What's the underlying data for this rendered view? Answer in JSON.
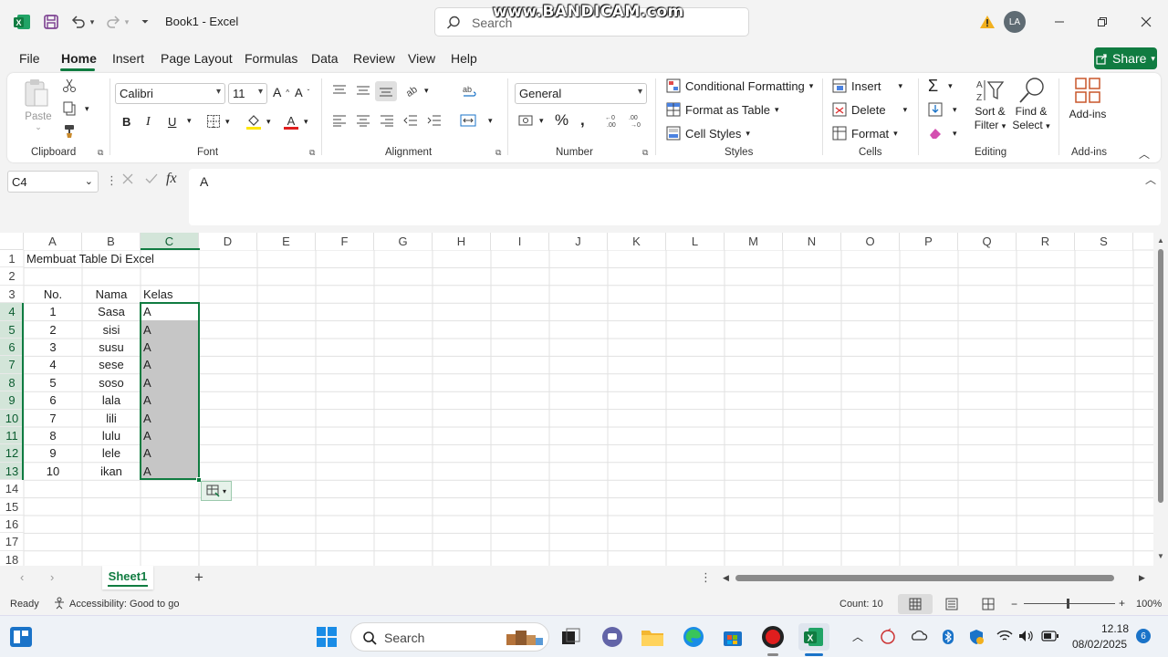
{
  "titlebar": {
    "doc_title": "Book1  -  Excel",
    "search_placeholder": "Search",
    "watermark": "www.BANDICAM.com",
    "avatar_initials": "LA"
  },
  "menu": {
    "tabs": [
      "File",
      "Home",
      "Insert",
      "Page Layout",
      "Formulas",
      "Data",
      "Review",
      "View",
      "Help"
    ],
    "active": "Home",
    "share_label": "Share"
  },
  "ribbon": {
    "clipboard": {
      "paste_label": "Paste",
      "group_label": "Clipboard"
    },
    "font": {
      "font_name": "Calibri",
      "font_size": "11",
      "group_label": "Font"
    },
    "alignment": {
      "group_label": "Alignment"
    },
    "number": {
      "format": "General",
      "group_label": "Number"
    },
    "styles": {
      "conditional_formatting": "Conditional Formatting",
      "format_as_table": "Format as Table",
      "cell_styles": "Cell Styles",
      "group_label": "Styles"
    },
    "cells": {
      "insert": "Insert",
      "delete": "Delete",
      "format": "Format",
      "group_label": "Cells"
    },
    "editing": {
      "sort_filter_1": "Sort &",
      "sort_filter_2": "Filter",
      "find_select_1": "Find &",
      "find_select_2": "Select",
      "group_label": "Editing"
    },
    "addins": {
      "addins_label": "Add-ins",
      "group_label": "Add-ins"
    }
  },
  "formula_bar": {
    "name_box": "C4",
    "content": "A"
  },
  "columns": [
    "A",
    "B",
    "C",
    "D",
    "E",
    "F",
    "G",
    "H",
    "I",
    "J",
    "K",
    "L",
    "M",
    "N",
    "O",
    "P",
    "Q",
    "R",
    "S"
  ],
  "rows": [
    "1",
    "2",
    "3",
    "4",
    "5",
    "6",
    "7",
    "8",
    "9",
    "10",
    "11",
    "12",
    "13",
    "14",
    "15",
    "16",
    "17",
    "18"
  ],
  "cells": {
    "title": "Membuat Table Di Excel",
    "header_no": "No.",
    "header_nama": "Nama",
    "header_kelas": "Kelas",
    "data": [
      {
        "no": "1",
        "nama": "Sasa",
        "kelas": "A"
      },
      {
        "no": "2",
        "nama": "sisi",
        "kelas": "A"
      },
      {
        "no": "3",
        "nama": "susu",
        "kelas": "A"
      },
      {
        "no": "4",
        "nama": "sese",
        "kelas": "A"
      },
      {
        "no": "5",
        "nama": "soso",
        "kelas": "A"
      },
      {
        "no": "6",
        "nama": "lala",
        "kelas": "A"
      },
      {
        "no": "7",
        "nama": "lili",
        "kelas": "A"
      },
      {
        "no": "8",
        "nama": "lulu",
        "kelas": "A"
      },
      {
        "no": "9",
        "nama": "lele",
        "kelas": "A"
      },
      {
        "no": "10",
        "nama": "ikan",
        "kelas": "A"
      }
    ]
  },
  "sheets": {
    "active": "Sheet1"
  },
  "status": {
    "ready": "Ready",
    "accessibility": "Accessibility: Good to go",
    "count": "Count: 10",
    "zoom": "100%"
  },
  "taskbar": {
    "search_label": "Search",
    "time": "12.18",
    "date": "08/02/2025",
    "notification_count": "6"
  },
  "colors": {
    "excel_green": "#107c41",
    "selection_fill": "#c6c6c6",
    "grid_line": "#e1e1e1"
  }
}
